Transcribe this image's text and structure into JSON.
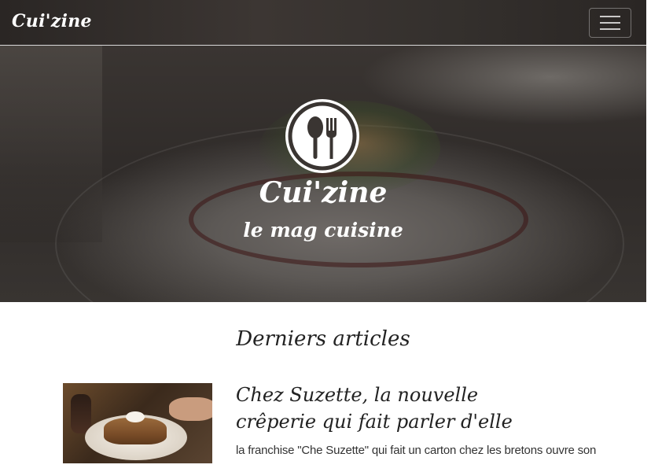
{
  "navbar": {
    "brand": "Cui'zine",
    "toggle_icon": "hamburger-menu-icon"
  },
  "hero": {
    "logo_icon": "spoon-fork-icon",
    "title": "Cui'zine",
    "subtitle": "le mag cuisine"
  },
  "articles": {
    "heading": "Derniers articles",
    "items": [
      {
        "title_line1": "Chez Suzette, la nouvelle",
        "title_line2": "crêperie qui fait parler d'elle",
        "excerpt": "la franchise \"Che Suzette\" qui fait un carton chez les bretons ouvre son"
      }
    ]
  },
  "colors": {
    "navbar_bg": "#2f2b29",
    "hero_overlay": "#3a3532",
    "text_dark": "#222222",
    "white": "#ffffff"
  }
}
